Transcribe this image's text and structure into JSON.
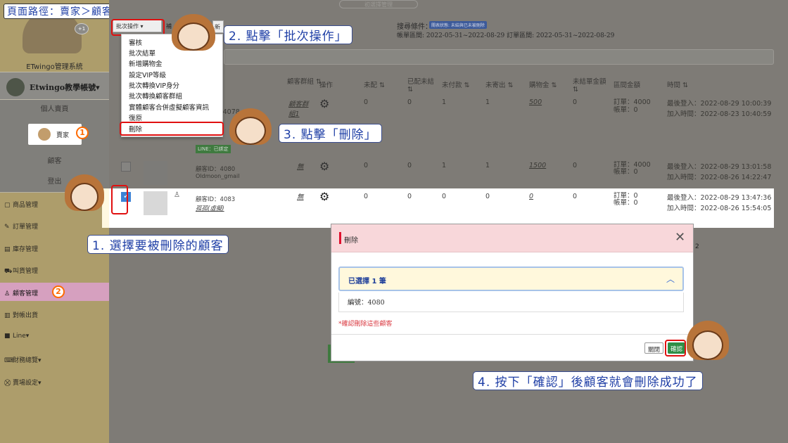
{
  "page_path": "頁面路徑：賣家＞顧客管理",
  "top_hidden_button": "初選擇管理",
  "sidebar": {
    "brand": "ETwingo管理系統",
    "badge_count": "+1",
    "account": "Etwingo教學帳號▾",
    "sub_items": [
      "個人賣頁",
      "賣家",
      "顧客",
      "登出"
    ],
    "nav_items": [
      "商品管理",
      "訂單管理",
      "庫存管理",
      "叫貨管理",
      "顧客管理",
      "對帳出貨",
      "Line▾",
      "財務總覽▾",
      "賣場設定▾"
    ]
  },
  "toolbar": {
    "batch_label": "批次操作 ▾",
    "partial_btn1": "補",
    "partial_btn2": "新"
  },
  "dropdown_items": [
    "審核",
    "批次結單",
    "新增購物金",
    "設定VIP等級",
    "批次轉換VIP身分",
    "批次轉換顧客群組",
    "實體顧客合併虛擬顧客資訊",
    "復原",
    "刪除"
  ],
  "filter": {
    "label": "搜尋條件：",
    "tag": "關表狀態: 未結與已未被刪除",
    "range": "帳單區間: 2022-05-31~2022-08-29   訂單區間: 2022-05-31~2022-08-29"
  },
  "table": {
    "headers": [
      "顧客群組 ⇅",
      "操作",
      "未配 ⇅",
      "已配未結 ⇅",
      "未付款 ⇅",
      "未寄出 ⇅",
      "購物金 ⇅",
      "未結單金額 ⇅",
      "區間金額",
      "時間 ⇅"
    ],
    "rows": [
      {
        "id": "顧客ID：4078",
        "group": "顧客群組1",
        "unmatched": "0",
        "matched": "0",
        "unpaid": "1",
        "unsent": "1",
        "credit": "500",
        "unsettled": "0",
        "amount": "訂單：4000\n帳單：0",
        "time": "最後登入：2022-08-29 10:00:39\n加入時間：2022-08-23 10:40:59",
        "line_tag": "LINE：已綁定"
      },
      {
        "id": "顧客ID：4080",
        "sub": "Oldmoon_gmail",
        "group": "無",
        "unmatched": "0",
        "matched": "0",
        "unpaid": "1",
        "unsent": "1",
        "credit": "1500",
        "unsettled": "0",
        "amount": "訂單：4000\n帳單：0",
        "time": "最後登入：2022-08-29 13:01:58\n加入時間：2022-08-26 14:22:47"
      },
      {
        "id": "顧客ID：4083",
        "sub": "孤孤(虛擬)",
        "group": "無",
        "unmatched": "0",
        "matched": "0",
        "unpaid": "0",
        "unsent": "0",
        "credit": "0",
        "unsettled": "0",
        "amount": "訂單：0\n帳單：0",
        "time": "最後登入：2022-08-29 13:47:36\n加入時間：2022-08-26 15:54:05"
      }
    ]
  },
  "modal": {
    "title": "刪除",
    "selected": "已選擇 1 筆",
    "item": "編號：4080",
    "warning": "*確認刪除這些顧客",
    "close_btn": "關閉",
    "confirm_btn": "確認"
  },
  "callouts": {
    "step1": "1. 選擇要被刪除的顧客",
    "step2": "2. 點擊「批次操作」",
    "step3": "3. 點擊「刪除」",
    "step4": "4. 按下「確認」後顧客就會刪除成功了"
  },
  "circle_numbers": {
    "one": "1",
    "two": "2"
  },
  "colors": {
    "accent_red": "#e01010",
    "callout_blue": "#1f3fa6",
    "highlight_orange": "#ff6a00",
    "modal_header": "#f8d7da"
  }
}
